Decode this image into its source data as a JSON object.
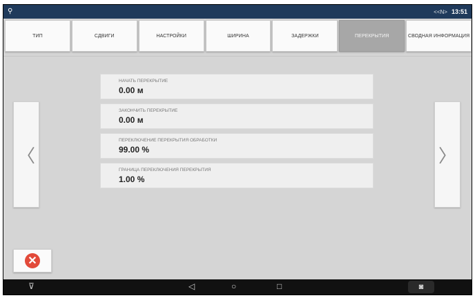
{
  "status_bar": {
    "time": "13:51",
    "signal": "<<N>"
  },
  "tabs": [
    {
      "label": "ТИП"
    },
    {
      "label": "СДВИГИ"
    },
    {
      "label": "НАСТРОЙКИ"
    },
    {
      "label": "ШИРИНА"
    },
    {
      "label": "ЗАДЕРЖКИ"
    },
    {
      "label": "ПЕРЕКРЫТИЯ"
    },
    {
      "label": "СВОДНАЯ ИНФОРМАЦИЯ"
    }
  ],
  "active_tab": "ПЕРЕКРЫТИЯ",
  "fields": [
    {
      "label": "НАЧАТЬ ПЕРЕКРЫТИЕ",
      "value": "0.00 м"
    },
    {
      "label": "ЗАКОНЧИТЬ ПЕРЕКРЫТИЕ",
      "value": "0.00 м"
    },
    {
      "label": "ПЕРЕКЛЮЧЕНИЕ ПЕРЕКРЫТИЯ ОБРАБОТКИ",
      "value": "99.00 %"
    },
    {
      "label": "ГРАНИЦА ПЕРЕКЛЮЧЕНИЯ ПЕРЕКРЫТИЯ",
      "value": "1.00 %"
    }
  ],
  "icons": {
    "prev": "chevron-left-icon",
    "next": "chevron-right-icon",
    "cancel": "close-icon",
    "camera": "camera-icon"
  },
  "colors": {
    "status_bar": "#1f3a5b",
    "active_tab": "#a7a7a7",
    "cancel": "#e24a3a"
  }
}
